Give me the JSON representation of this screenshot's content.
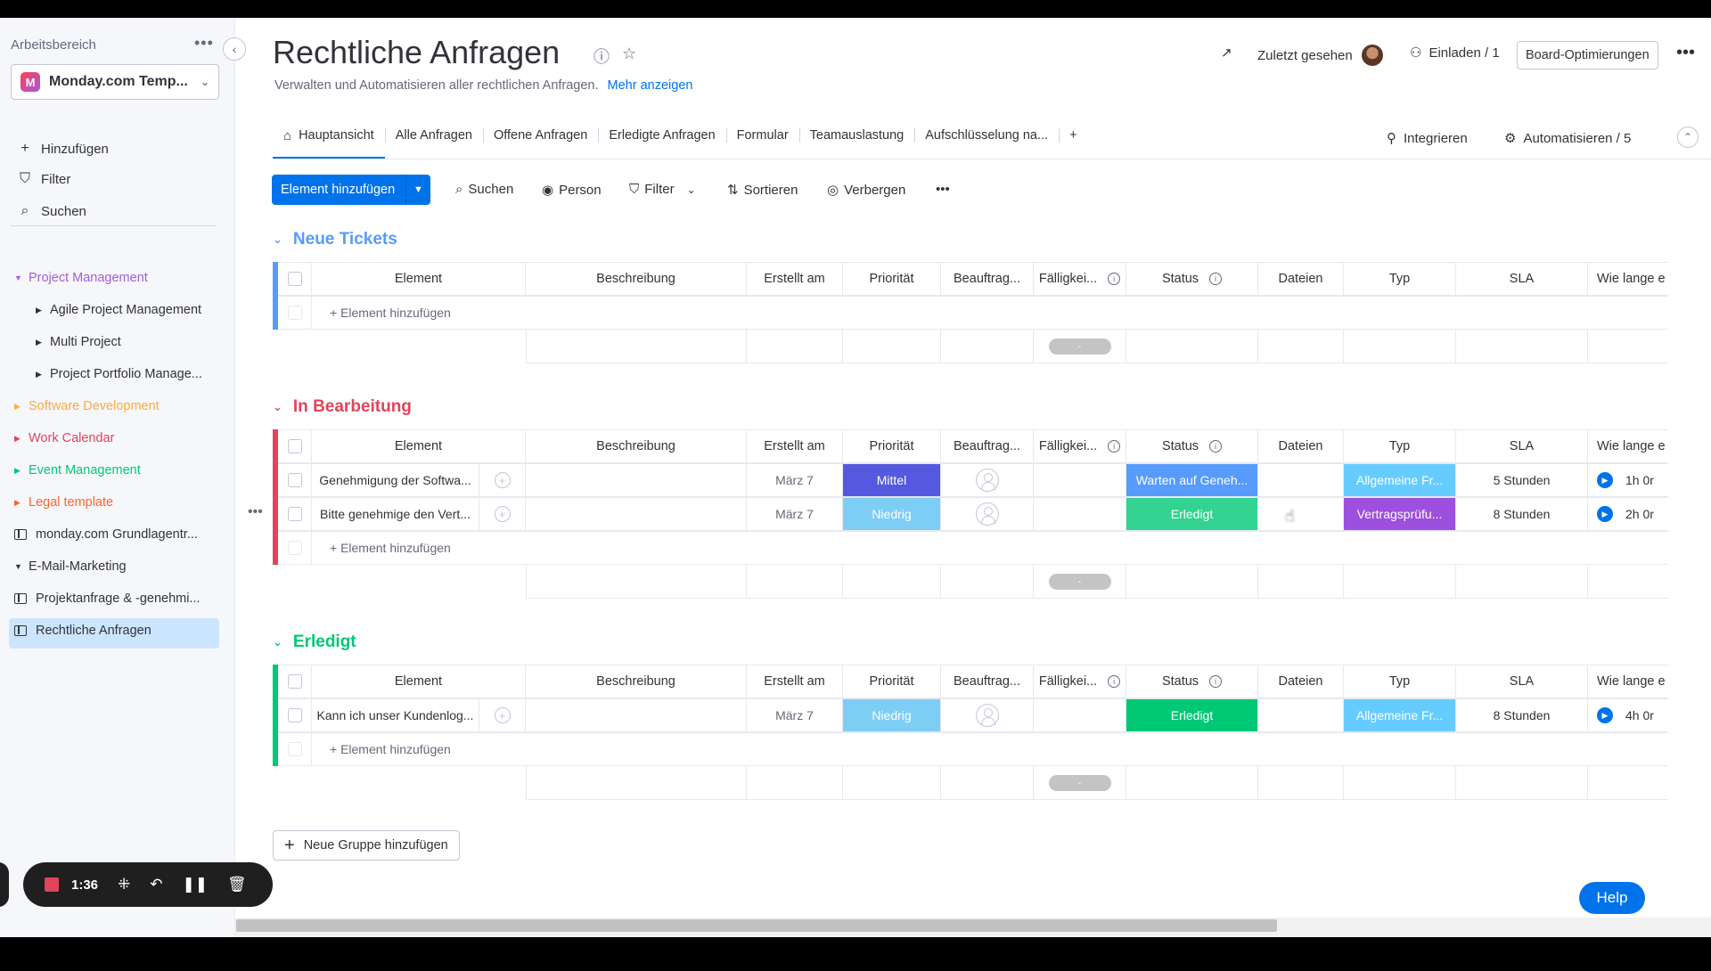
{
  "sidebar": {
    "workspace_label": "Arbeitsbereich",
    "workspace_name": "Monday.com Temp...",
    "actions": [
      {
        "label": "Hinzufügen",
        "icon": "plus-icon"
      },
      {
        "label": "Filter",
        "icon": "filter-icon"
      },
      {
        "label": "Suchen",
        "icon": "search-icon"
      }
    ],
    "tree": [
      {
        "label": "Project Management",
        "color": "#a25ddc",
        "level": 0,
        "expanded": true
      },
      {
        "label": "Agile Project Management",
        "color": "#323338",
        "level": 1
      },
      {
        "label": "Multi Project",
        "color": "#323338",
        "level": 1
      },
      {
        "label": "Project Portfolio Manage...",
        "color": "#323338",
        "level": 1
      },
      {
        "label": "Software Development",
        "color": "#fdab3d",
        "level": 0
      },
      {
        "label": "Work Calendar",
        "color": "#e2445c",
        "level": 0
      },
      {
        "label": "Event Management",
        "color": "#00c875",
        "level": 0
      },
      {
        "label": "Legal template",
        "color": "#ff642e",
        "level": 0
      },
      {
        "label": "monday.com Grundlagentr...",
        "color": "#323338",
        "level": 0,
        "board": true
      },
      {
        "label": "E-Mail-Marketing",
        "color": "#323338",
        "level": 0,
        "expanded": true
      },
      {
        "label": "Projektanfrage & -genehmi...",
        "color": "#323338",
        "level": 0,
        "board": true
      },
      {
        "label": "Rechtliche Anfragen",
        "color": "#323338",
        "level": 0,
        "board": true,
        "active": true
      }
    ]
  },
  "recorder": {
    "time": "1:36"
  },
  "header": {
    "title": "Rechtliche Anfragen",
    "subtitle": "Verwalten und Automatisieren aller rechtlichen Anfragen.",
    "more_link": "Mehr anzeigen",
    "last_seen": "Zuletzt gesehen",
    "invite": "Einladen / 1",
    "optimize": "Board-Optimierungen"
  },
  "tabs": [
    {
      "label": "Hauptansicht",
      "active": true
    },
    {
      "label": "Alle Anfragen"
    },
    {
      "label": "Offene Anfragen"
    },
    {
      "label": "Erledigte Anfragen"
    },
    {
      "label": "Formular"
    },
    {
      "label": "Teamauslastung"
    },
    {
      "label": "Aufschlüsselung na..."
    },
    {
      "label": "+"
    }
  ],
  "tab_actions": {
    "integrate": "Integrieren",
    "automate": "Automatisieren / 5"
  },
  "toolbar": {
    "add_item": "Element hinzufügen",
    "search": "Suchen",
    "person": "Person",
    "filter": "Filter",
    "sort": "Sortieren",
    "hide": "Verbergen"
  },
  "columns": [
    "Element",
    "Beschreibung",
    "Erstellt am",
    "Priorität",
    "Beauftrag...",
    "Fälligkei...",
    "Status",
    "Dateien",
    "Typ",
    "SLA",
    "Wie lange e"
  ],
  "add_row_label": "+ Element hinzufügen",
  "summary_dash": "-",
  "groups": [
    {
      "title": "Neue Tickets",
      "color": "#579bfc",
      "rows": []
    },
    {
      "title": "In Bearbeitung",
      "color": "#e2445c",
      "title_color": "#e2445c",
      "rows": [
        {
          "element": "Genehmigung der Softwa...",
          "created": "März 7",
          "priority": "Mittel",
          "priority_color": "#5559df",
          "status": "Warten auf Geneh...",
          "status_color": "#579bfc",
          "type": "Allgemeine Fr...",
          "type_color": "#66ccff",
          "sla": "5 Stunden",
          "duration": "1h 0r"
        },
        {
          "element": "Bitte genehmige den Vert...",
          "created": "März 7",
          "priority": "Niedrig",
          "priority_color": "#7ecdf5",
          "status": "Erledigt",
          "status_color": "#33d391",
          "type": "Vertragsprüfu...",
          "type_color": "#9d50dd",
          "sla": "8 Stunden",
          "duration": "2h 0r"
        }
      ]
    },
    {
      "title": "Erledigt",
      "color": "#00c875",
      "title_color": "#00c875",
      "rows": [
        {
          "element": "Kann ich unser Kundenlog...",
          "created": "März 7",
          "priority": "Niedrig",
          "priority_color": "#7ecdf5",
          "status": "Erledigt",
          "status_color": "#00c875",
          "type": "Allgemeine Fr...",
          "type_color": "#66ccff",
          "sla": "8 Stunden",
          "duration": "4h 0r"
        }
      ]
    }
  ],
  "new_group": "Neue Gruppe hinzufügen",
  "help": "Help"
}
